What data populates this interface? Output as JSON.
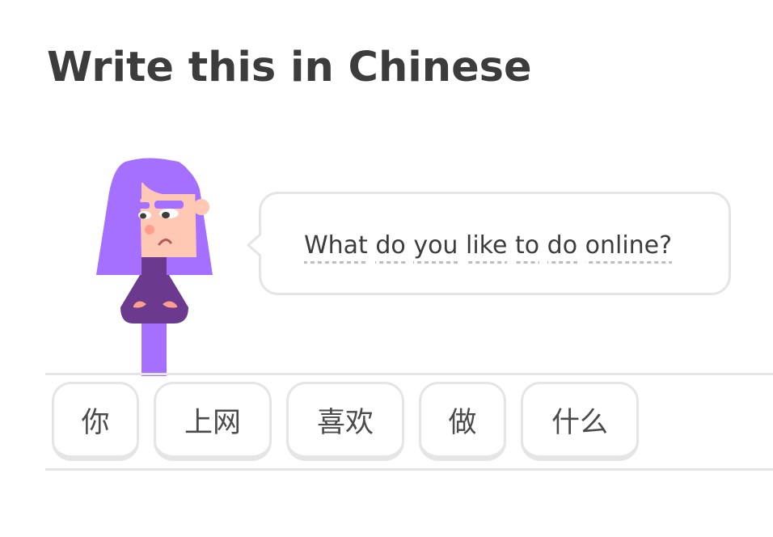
{
  "header": {
    "title": "Write this in Chinese"
  },
  "character": {
    "icon": "lily-character-icon",
    "hair_color": "#a570ff",
    "skin_color": "#ffc8b4",
    "shirt_color": "#6b3a8f"
  },
  "speech_bubble": {
    "words": [
      "What",
      "do",
      "you",
      "like",
      "to",
      "do",
      "online?"
    ]
  },
  "word_bank": {
    "tiles": [
      "你",
      "上网",
      "喜欢",
      "做",
      "什么"
    ]
  },
  "colors": {
    "text": "#3c3c3c",
    "border": "#e5e5e5",
    "dash": "#bdbdbd"
  }
}
